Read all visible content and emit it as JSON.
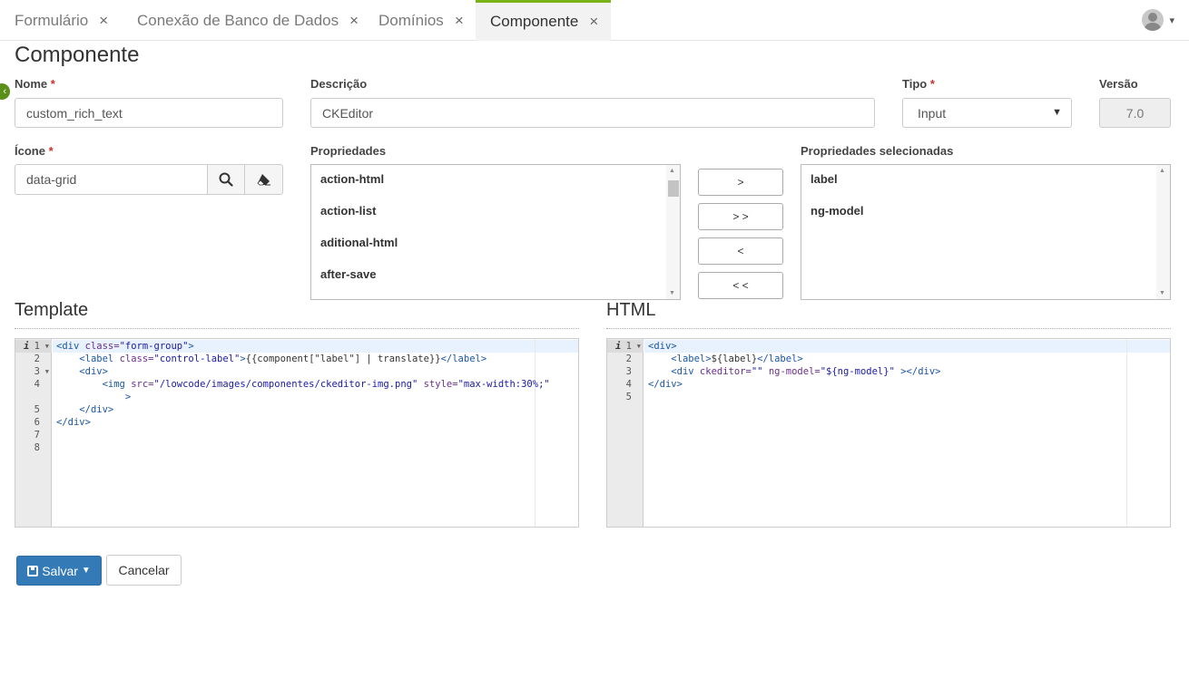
{
  "tabs": [
    {
      "label": "Formulário",
      "close": "×"
    },
    {
      "label": "Conexão de Banco de Dados",
      "close": "×"
    },
    {
      "label": "Domínios",
      "close": "×"
    },
    {
      "label": "Componente",
      "close": "×",
      "active": true
    }
  ],
  "page_title": "Componente",
  "form": {
    "nome_label": "Nome",
    "nome_value": "custom_rich_text",
    "descricao_label": "Descrição",
    "descricao_value": "CKEditor",
    "tipo_label": "Tipo",
    "tipo_value": "Input",
    "versao_label": "Versão",
    "versao_value": "7.0",
    "icone_label": "Ícone",
    "icone_value": "data-grid",
    "required_mark": "*"
  },
  "propriedades": {
    "label": "Propriedades",
    "items": [
      "action-html",
      "action-list",
      "aditional-html",
      "after-save"
    ]
  },
  "selecionadas": {
    "label": "Propriedades selecionadas",
    "items": [
      "label",
      "ng-model"
    ]
  },
  "move_buttons": [
    ">",
    "> >",
    "<",
    "< <"
  ],
  "template_editor": {
    "title": "Template",
    "line_numbers": [
      "1",
      "2",
      "3",
      "4",
      "",
      "5",
      "6",
      "7",
      "8"
    ]
  },
  "html_editor": {
    "title": "HTML",
    "line_numbers": [
      "1",
      "2",
      "3",
      "4",
      "5"
    ]
  },
  "buttons": {
    "save": "Salvar",
    "cancel": "Cancelar"
  },
  "icons": {
    "search": "search-icon",
    "eraser": "eraser-icon",
    "user": "user-avatar-icon"
  },
  "colors": {
    "accent": "#7ab317",
    "primary": "#337ab7",
    "required": "#c9302c"
  }
}
